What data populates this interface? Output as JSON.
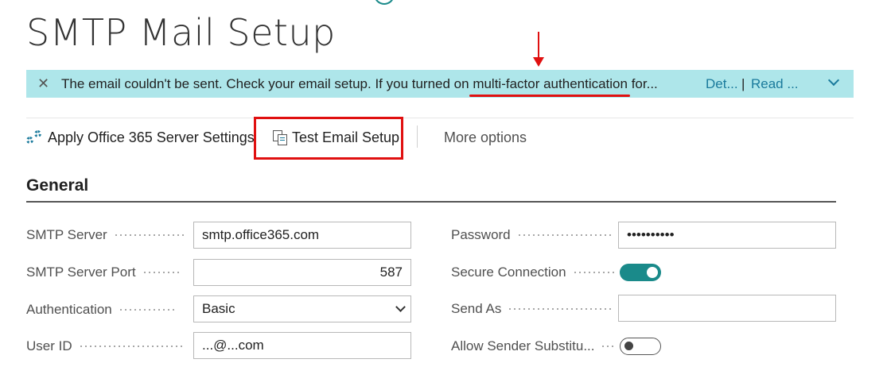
{
  "page": {
    "title": "SMTP Mail Setup"
  },
  "banner": {
    "message_before": "The email couldn't be sent. Check your email setup. If you turned on ",
    "message_highlight": "multi-factor authentication",
    "message_after": " for...",
    "details_link": "Det...",
    "separator": "|",
    "read_more_link": "Read ..."
  },
  "toolbar": {
    "apply_label": "Apply Office 365 Server Settings",
    "test_label": "Test Email Setup",
    "more_label": "More options"
  },
  "section": {
    "title": "General"
  },
  "fields": {
    "smtp_server": {
      "label": "SMTP Server",
      "value": "smtp.office365.com"
    },
    "smtp_port": {
      "label": "SMTP Server Port",
      "value": "587"
    },
    "authentication": {
      "label": "Authentication",
      "value": "Basic"
    },
    "user_id": {
      "label": "User ID",
      "value": "...@...com"
    },
    "password": {
      "label": "Password",
      "value": "••••••••••"
    },
    "secure_connection": {
      "label": "Secure Connection",
      "enabled": true
    },
    "send_as": {
      "label": "Send As",
      "value": ""
    },
    "allow_sender_substitution": {
      "label": "Allow Sender Substitu...",
      "enabled": false
    }
  },
  "colors": {
    "banner_bg": "#aee6ea",
    "accent": "#1a8a8a",
    "annotation_red": "#e01010"
  }
}
